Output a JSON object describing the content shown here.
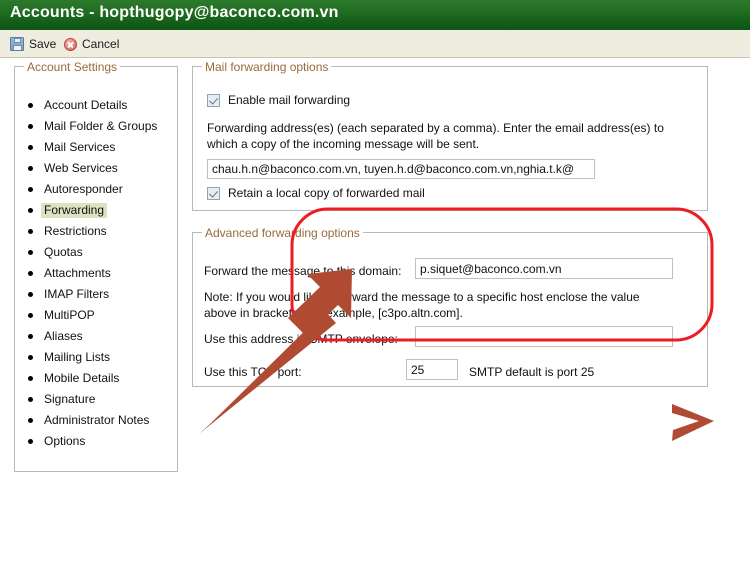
{
  "window": {
    "title": "Accounts - hopthugopy@baconco.com.vn"
  },
  "toolbar": {
    "save_label": "Save",
    "cancel_label": "Cancel",
    "save_icon": "floppy-disk-icon",
    "cancel_icon": "cancel-circle-icon"
  },
  "sidebar": {
    "legend": "Account Settings",
    "selected": "Forwarding",
    "items": [
      {
        "label": "Account Details"
      },
      {
        "label": "Mail Folder & Groups"
      },
      {
        "label": "Mail Services"
      },
      {
        "label": "Web Services"
      },
      {
        "label": "Autoresponder"
      },
      {
        "label": "Forwarding"
      },
      {
        "label": "Restrictions"
      },
      {
        "label": "Quotas"
      },
      {
        "label": "Attachments"
      },
      {
        "label": "IMAP Filters"
      },
      {
        "label": "MultiPOP"
      },
      {
        "label": "Aliases"
      },
      {
        "label": "Mailing Lists"
      },
      {
        "label": "Mobile Details"
      },
      {
        "label": "Signature"
      },
      {
        "label": "Administrator Notes"
      },
      {
        "label": "Options"
      }
    ]
  },
  "mail_forwarding": {
    "legend": "Mail forwarding options",
    "enable_label": "Enable mail forwarding",
    "enable_checked": true,
    "description_line1": "Forwarding address(es) (each separated by a comma). Enter the email address(es) to",
    "description_line2": "which a copy of the incoming message will be sent.",
    "addresses_value": "chau.h.n@baconco.com.vn, tuyen.h.d@baconco.com.vn,nghia.t.k@",
    "retain_label": "Retain a local copy of forwarded mail",
    "retain_checked": true
  },
  "advanced_forwarding": {
    "legend": "Advanced forwarding options",
    "domain_label": "Forward the message to this domain:",
    "domain_value": "p.siquet@baconco.com.vn",
    "note_line1": "Note: If you would like to forward the message to a specific host enclose the value",
    "note_line2": "above in brackets. For example, [c3po.altn.com].",
    "envelope_label": "Use this address in SMTP envelope:",
    "envelope_value": "",
    "port_label": "Use this TCP port:",
    "port_value": "25",
    "port_hint": "SMTP default is port 25"
  },
  "annotation": {
    "highlight_color": "#ee1c22",
    "arrow_color": "#b14a33",
    "shapes": [
      "red-rounded-rectangle-around-advanced-options",
      "red-arrow-pointing-to-domain-field",
      "red-chevron-bottom-right"
    ]
  },
  "colors": {
    "titlebar_green": "#1f6b20",
    "toolbar_cream": "#efece0",
    "legend_brown": "#9b6a3c",
    "selected_highlight": "#dde3c0"
  }
}
